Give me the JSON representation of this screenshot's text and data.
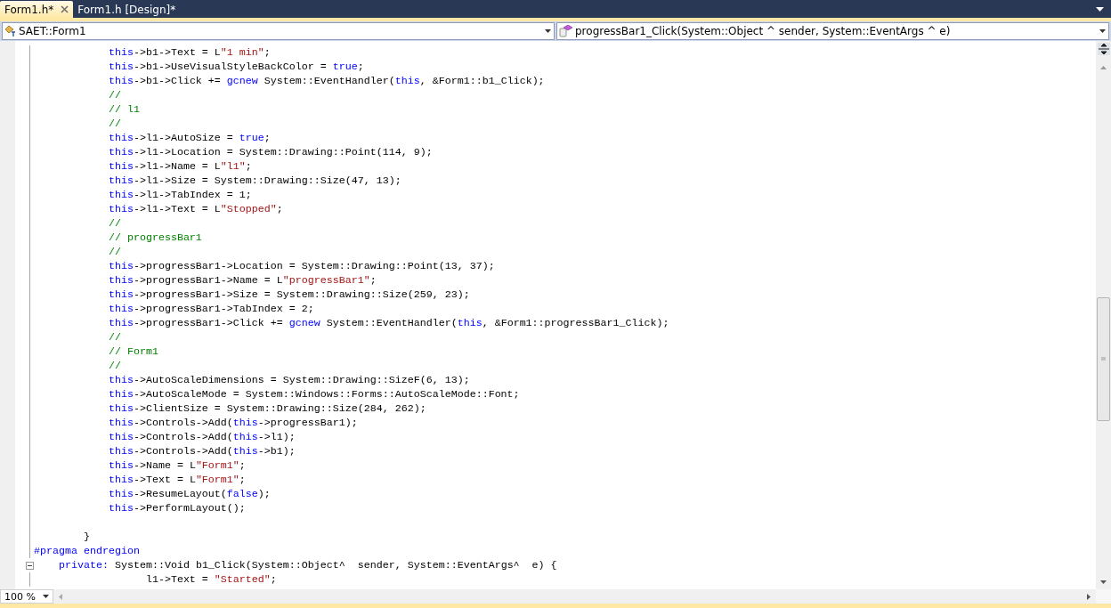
{
  "tabs": [
    {
      "label": "Form1.h*",
      "selected": true,
      "closable": true
    },
    {
      "label": "Form1.h [Design]*",
      "selected": false,
      "closable": false
    }
  ],
  "navigation_bar": {
    "type_combo": "SAET::Form1",
    "member_combo": "progressBar1_Click(System::Object ^ sender, System::EventArgs ^ e)"
  },
  "editor": {
    "lines": [
      {
        "kind": "code",
        "segments": [
          {
            "kind": "keyword",
            "text": "            this"
          },
          {
            "kind": "plain",
            "text": "->b1->Text = L"
          },
          {
            "kind": "string",
            "text": "\"1 min\""
          },
          {
            "kind": "plain",
            "text": ";"
          }
        ]
      },
      {
        "kind": "code",
        "segments": [
          {
            "kind": "keyword",
            "text": "            this"
          },
          {
            "kind": "plain",
            "text": "->b1->UseVisualStyleBackColor = "
          },
          {
            "kind": "keyword",
            "text": "true"
          },
          {
            "kind": "plain",
            "text": ";"
          }
        ]
      },
      {
        "kind": "code",
        "segments": [
          {
            "kind": "keyword",
            "text": "            this"
          },
          {
            "kind": "plain",
            "text": "->b1->Click += "
          },
          {
            "kind": "keyword",
            "text": "gcnew"
          },
          {
            "kind": "plain",
            "text": " System::EventHandler("
          },
          {
            "kind": "keyword",
            "text": "this"
          },
          {
            "kind": "plain",
            "text": ", &Form1::b1_Click);"
          }
        ]
      },
      {
        "kind": "code",
        "segments": [
          {
            "kind": "comment",
            "text": "            //"
          }
        ]
      },
      {
        "kind": "code",
        "segments": [
          {
            "kind": "comment",
            "text": "            // l1"
          }
        ]
      },
      {
        "kind": "code",
        "segments": [
          {
            "kind": "comment",
            "text": "            //"
          }
        ]
      },
      {
        "kind": "code",
        "segments": [
          {
            "kind": "keyword",
            "text": "            this"
          },
          {
            "kind": "plain",
            "text": "->l1->AutoSize = "
          },
          {
            "kind": "keyword",
            "text": "true"
          },
          {
            "kind": "plain",
            "text": ";"
          }
        ]
      },
      {
        "kind": "code",
        "segments": [
          {
            "kind": "keyword",
            "text": "            this"
          },
          {
            "kind": "plain",
            "text": "->l1->Location = System::Drawing::Point(114, 9);"
          }
        ]
      },
      {
        "kind": "code",
        "segments": [
          {
            "kind": "keyword",
            "text": "            this"
          },
          {
            "kind": "plain",
            "text": "->l1->Name = L"
          },
          {
            "kind": "string",
            "text": "\"l1\""
          },
          {
            "kind": "plain",
            "text": ";"
          }
        ]
      },
      {
        "kind": "code",
        "segments": [
          {
            "kind": "keyword",
            "text": "            this"
          },
          {
            "kind": "plain",
            "text": "->l1->Size = System::Drawing::Size(47, 13);"
          }
        ]
      },
      {
        "kind": "code",
        "segments": [
          {
            "kind": "keyword",
            "text": "            this"
          },
          {
            "kind": "plain",
            "text": "->l1->TabIndex = 1;"
          }
        ]
      },
      {
        "kind": "code",
        "segments": [
          {
            "kind": "keyword",
            "text": "            this"
          },
          {
            "kind": "plain",
            "text": "->l1->Text = L"
          },
          {
            "kind": "string",
            "text": "\"Stopped\""
          },
          {
            "kind": "plain",
            "text": ";"
          }
        ]
      },
      {
        "kind": "code",
        "segments": [
          {
            "kind": "comment",
            "text": "            //"
          }
        ]
      },
      {
        "kind": "code",
        "segments": [
          {
            "kind": "comment",
            "text": "            // progressBar1"
          }
        ]
      },
      {
        "kind": "code",
        "segments": [
          {
            "kind": "comment",
            "text": "            //"
          }
        ]
      },
      {
        "kind": "code",
        "segments": [
          {
            "kind": "keyword",
            "text": "            this"
          },
          {
            "kind": "plain",
            "text": "->progressBar1->Location = System::Drawing::Point(13, 37);"
          }
        ]
      },
      {
        "kind": "code",
        "segments": [
          {
            "kind": "keyword",
            "text": "            this"
          },
          {
            "kind": "plain",
            "text": "->progressBar1->Name = L"
          },
          {
            "kind": "string",
            "text": "\"progressBar1\""
          },
          {
            "kind": "plain",
            "text": ";"
          }
        ]
      },
      {
        "kind": "code",
        "segments": [
          {
            "kind": "keyword",
            "text": "            this"
          },
          {
            "kind": "plain",
            "text": "->progressBar1->Size = System::Drawing::Size(259, 23);"
          }
        ]
      },
      {
        "kind": "code",
        "segments": [
          {
            "kind": "keyword",
            "text": "            this"
          },
          {
            "kind": "plain",
            "text": "->progressBar1->TabIndex = 2;"
          }
        ]
      },
      {
        "kind": "code",
        "segments": [
          {
            "kind": "keyword",
            "text": "            this"
          },
          {
            "kind": "plain",
            "text": "->progressBar1->Click += "
          },
          {
            "kind": "keyword",
            "text": "gcnew"
          },
          {
            "kind": "plain",
            "text": " System::EventHandler("
          },
          {
            "kind": "keyword",
            "text": "this"
          },
          {
            "kind": "plain",
            "text": ", &Form1::progressBar1_Click);"
          }
        ]
      },
      {
        "kind": "code",
        "segments": [
          {
            "kind": "comment",
            "text": "            //"
          }
        ]
      },
      {
        "kind": "code",
        "segments": [
          {
            "kind": "comment",
            "text": "            // Form1"
          }
        ]
      },
      {
        "kind": "code",
        "segments": [
          {
            "kind": "comment",
            "text": "            //"
          }
        ]
      },
      {
        "kind": "code",
        "segments": [
          {
            "kind": "keyword",
            "text": "            this"
          },
          {
            "kind": "plain",
            "text": "->AutoScaleDimensions = System::Drawing::SizeF(6, 13);"
          }
        ]
      },
      {
        "kind": "code",
        "segments": [
          {
            "kind": "keyword",
            "text": "            this"
          },
          {
            "kind": "plain",
            "text": "->AutoScaleMode = System::Windows::Forms::AutoScaleMode::Font;"
          }
        ]
      },
      {
        "kind": "code",
        "segments": [
          {
            "kind": "keyword",
            "text": "            this"
          },
          {
            "kind": "plain",
            "text": "->ClientSize = System::Drawing::Size(284, 262);"
          }
        ]
      },
      {
        "kind": "code",
        "segments": [
          {
            "kind": "keyword",
            "text": "            this"
          },
          {
            "kind": "plain",
            "text": "->Controls->Add("
          },
          {
            "kind": "keyword",
            "text": "this"
          },
          {
            "kind": "plain",
            "text": "->progressBar1);"
          }
        ]
      },
      {
        "kind": "code",
        "segments": [
          {
            "kind": "keyword",
            "text": "            this"
          },
          {
            "kind": "plain",
            "text": "->Controls->Add("
          },
          {
            "kind": "keyword",
            "text": "this"
          },
          {
            "kind": "plain",
            "text": "->l1);"
          }
        ]
      },
      {
        "kind": "code",
        "segments": [
          {
            "kind": "keyword",
            "text": "            this"
          },
          {
            "kind": "plain",
            "text": "->Controls->Add("
          },
          {
            "kind": "keyword",
            "text": "this"
          },
          {
            "kind": "plain",
            "text": "->b1);"
          }
        ]
      },
      {
        "kind": "code",
        "segments": [
          {
            "kind": "keyword",
            "text": "            this"
          },
          {
            "kind": "plain",
            "text": "->Name = L"
          },
          {
            "kind": "string",
            "text": "\"Form1\""
          },
          {
            "kind": "plain",
            "text": ";"
          }
        ]
      },
      {
        "kind": "code",
        "segments": [
          {
            "kind": "keyword",
            "text": "            this"
          },
          {
            "kind": "plain",
            "text": "->Text = L"
          },
          {
            "kind": "string",
            "text": "\"Form1\""
          },
          {
            "kind": "plain",
            "text": ";"
          }
        ]
      },
      {
        "kind": "code",
        "segments": [
          {
            "kind": "keyword",
            "text": "            this"
          },
          {
            "kind": "plain",
            "text": "->ResumeLayout("
          },
          {
            "kind": "keyword",
            "text": "false"
          },
          {
            "kind": "plain",
            "text": ");"
          }
        ]
      },
      {
        "kind": "code",
        "segments": [
          {
            "kind": "keyword",
            "text": "            this"
          },
          {
            "kind": "plain",
            "text": "->PerformLayout();"
          }
        ]
      },
      {
        "kind": "blank"
      },
      {
        "kind": "code",
        "segments": [
          {
            "kind": "plain",
            "text": "        }"
          }
        ]
      },
      {
        "kind": "code",
        "segments": [
          {
            "kind": "directive",
            "text": "#pragma endregion"
          }
        ]
      },
      {
        "kind": "code",
        "expanded": true,
        "segments": [
          {
            "kind": "keyword",
            "text": "    private:"
          },
          {
            "kind": "plain",
            "text": " System::Void b1_Click(System::Object^  sender, System::EventArgs^  e) {"
          }
        ]
      },
      {
        "kind": "code",
        "segments": [
          {
            "kind": "plain",
            "text": "                  l1->Text = "
          },
          {
            "kind": "string",
            "text": "\"Started\""
          },
          {
            "kind": "plain",
            "text": ";"
          }
        ]
      }
    ]
  },
  "zoom_combo": "100 %"
}
